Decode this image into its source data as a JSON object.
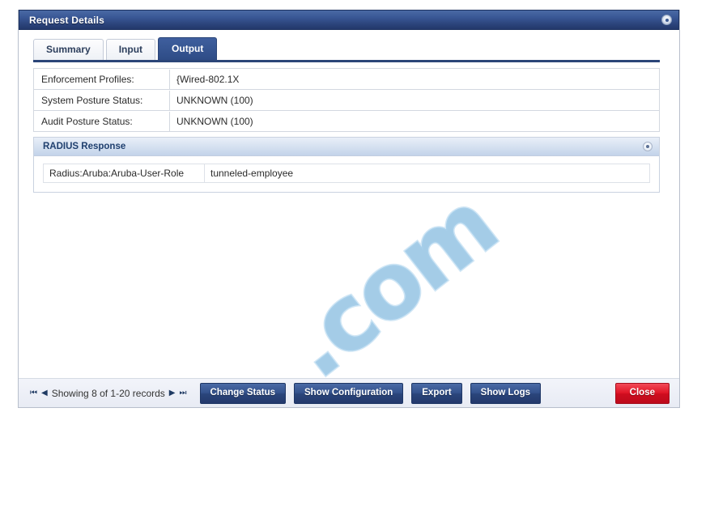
{
  "dialog": {
    "title": "Request Details",
    "close_icon": "close-circle-icon"
  },
  "tabs": [
    {
      "label": "Summary",
      "active": false
    },
    {
      "label": "Input",
      "active": false
    },
    {
      "label": "Output",
      "active": true
    }
  ],
  "info_table": {
    "rows": [
      {
        "label": "Enforcement Profiles:",
        "value": "{Wired-802.1X"
      },
      {
        "label": "System Posture Status:",
        "value": "UNKNOWN (100)"
      },
      {
        "label": "Audit Posture Status:",
        "value": "UNKNOWN (100)"
      }
    ]
  },
  "radius_panel": {
    "title": "RADIUS Response",
    "collapse_icon": "collapse-circle-icon",
    "attributes": [
      {
        "key": "Radius:Aruba:Aruba-User-Role",
        "value": "tunneled-employee"
      }
    ]
  },
  "footer": {
    "pager": {
      "first_icon": "⏮",
      "prev_icon": "◀",
      "text": "Showing 8 of 1-20 records",
      "next_icon": "▶",
      "last_icon": "⏭"
    },
    "buttons": [
      {
        "label": "Change Status",
        "style": "primary"
      },
      {
        "label": "Show Configuration",
        "style": "primary"
      },
      {
        "label": "Export",
        "style": "primary"
      },
      {
        "label": "Show Logs",
        "style": "primary"
      },
      {
        "label": "Close",
        "style": "danger"
      }
    ]
  },
  "watermark": {
    "text": ".com"
  },
  "colors": {
    "title_bar": "#2b437a",
    "active_tab": "#2e4c86",
    "primary_button": "#2a457b",
    "danger_button": "#cf0d1f",
    "panel_header": "#d4e0f0",
    "watermark": "#81b9de"
  }
}
